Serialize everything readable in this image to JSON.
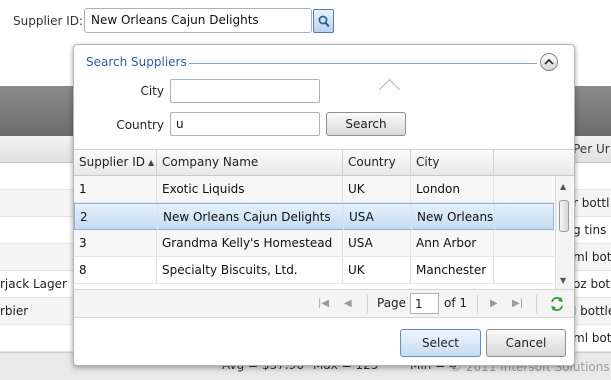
{
  "supplier": {
    "label": "Supplier ID:",
    "value": "New Orleans Cajun Delights"
  },
  "background": {
    "per_unit_header": "Per Ur",
    "rows": [
      {
        "left": "",
        "right": ""
      },
      {
        "left": "",
        "right": ""
      },
      {
        "left": "",
        "right": "r bottl"
      },
      {
        "left": "",
        "right": "g tins"
      },
      {
        "left": "",
        "right": "ml bot"
      },
      {
        "left": "rjack Lager",
        "right": "oz bot"
      },
      {
        "left": "rbier",
        "right": "l bottle"
      },
      {
        "left": "",
        "right": "ml bot"
      }
    ],
    "summary": {
      "avg": "Avg = $37.96",
      "max": "Max = 125",
      "min": "Min = 4"
    },
    "copyright": "© 2011 Intersoft Solutions"
  },
  "popup": {
    "title": "Search Suppliers",
    "city_label": "City",
    "city_value": "",
    "country_label": "Country",
    "country_value": "u",
    "search_label": "Search",
    "columns": [
      "Supplier ID",
      "Company Name",
      "Country",
      "City"
    ],
    "rows": [
      {
        "id": "1",
        "company": "Exotic Liquids",
        "country": "UK",
        "city": "London"
      },
      {
        "id": "2",
        "company": "New Orleans Cajun Delights",
        "country": "USA",
        "city": "New Orleans"
      },
      {
        "id": "3",
        "company": "Grandma Kelly's Homestead",
        "country": "USA",
        "city": "Ann Arbor"
      },
      {
        "id": "8",
        "company": "Specialty Biscuits, Ltd.",
        "country": "UK",
        "city": "Manchester"
      }
    ],
    "selected_row": 1,
    "pager": {
      "page_label": "Page",
      "page_value": "1",
      "of_label": "of 1"
    },
    "select_label": "Select",
    "cancel_label": "Cancel"
  },
  "colors": {
    "accent": "#2b5f9e",
    "selection": "#c5dcf2",
    "header_band": "#7a7a7a"
  }
}
